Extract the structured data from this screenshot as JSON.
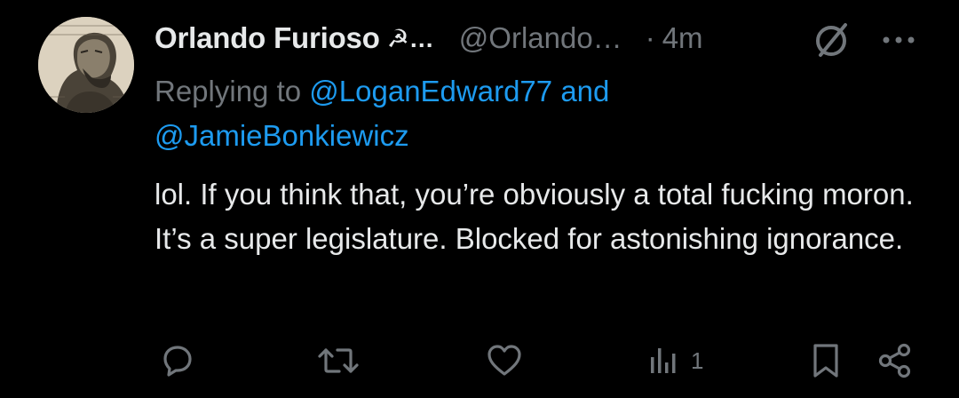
{
  "tweet": {
    "display_name": "Orlando Furioso",
    "name_emoji": "☭…",
    "handle": "@Orlando…",
    "separator": "·",
    "timestamp": "4m",
    "replying_prefix": "Replying to",
    "replying_user_1": "@LoganEdward77",
    "replying_conjunction": "and",
    "replying_user_2": "@JamieBonkiewicz",
    "body": "lol. If you think that, you’re obviously a total fucking moron. It’s a super legislature. Blocked for astonishing ignorance.",
    "views_count": "1"
  },
  "icons": {
    "grok": "grok-icon",
    "more": "more-icon",
    "reply": "reply-icon",
    "retweet": "retweet-icon",
    "like": "like-icon",
    "views": "views-icon",
    "bookmark": "bookmark-icon",
    "share": "share-icon"
  },
  "colors": {
    "background": "#000000",
    "primary_text": "#e7e9ea",
    "secondary_text": "#71767b",
    "accent": "#1d9bf0"
  }
}
